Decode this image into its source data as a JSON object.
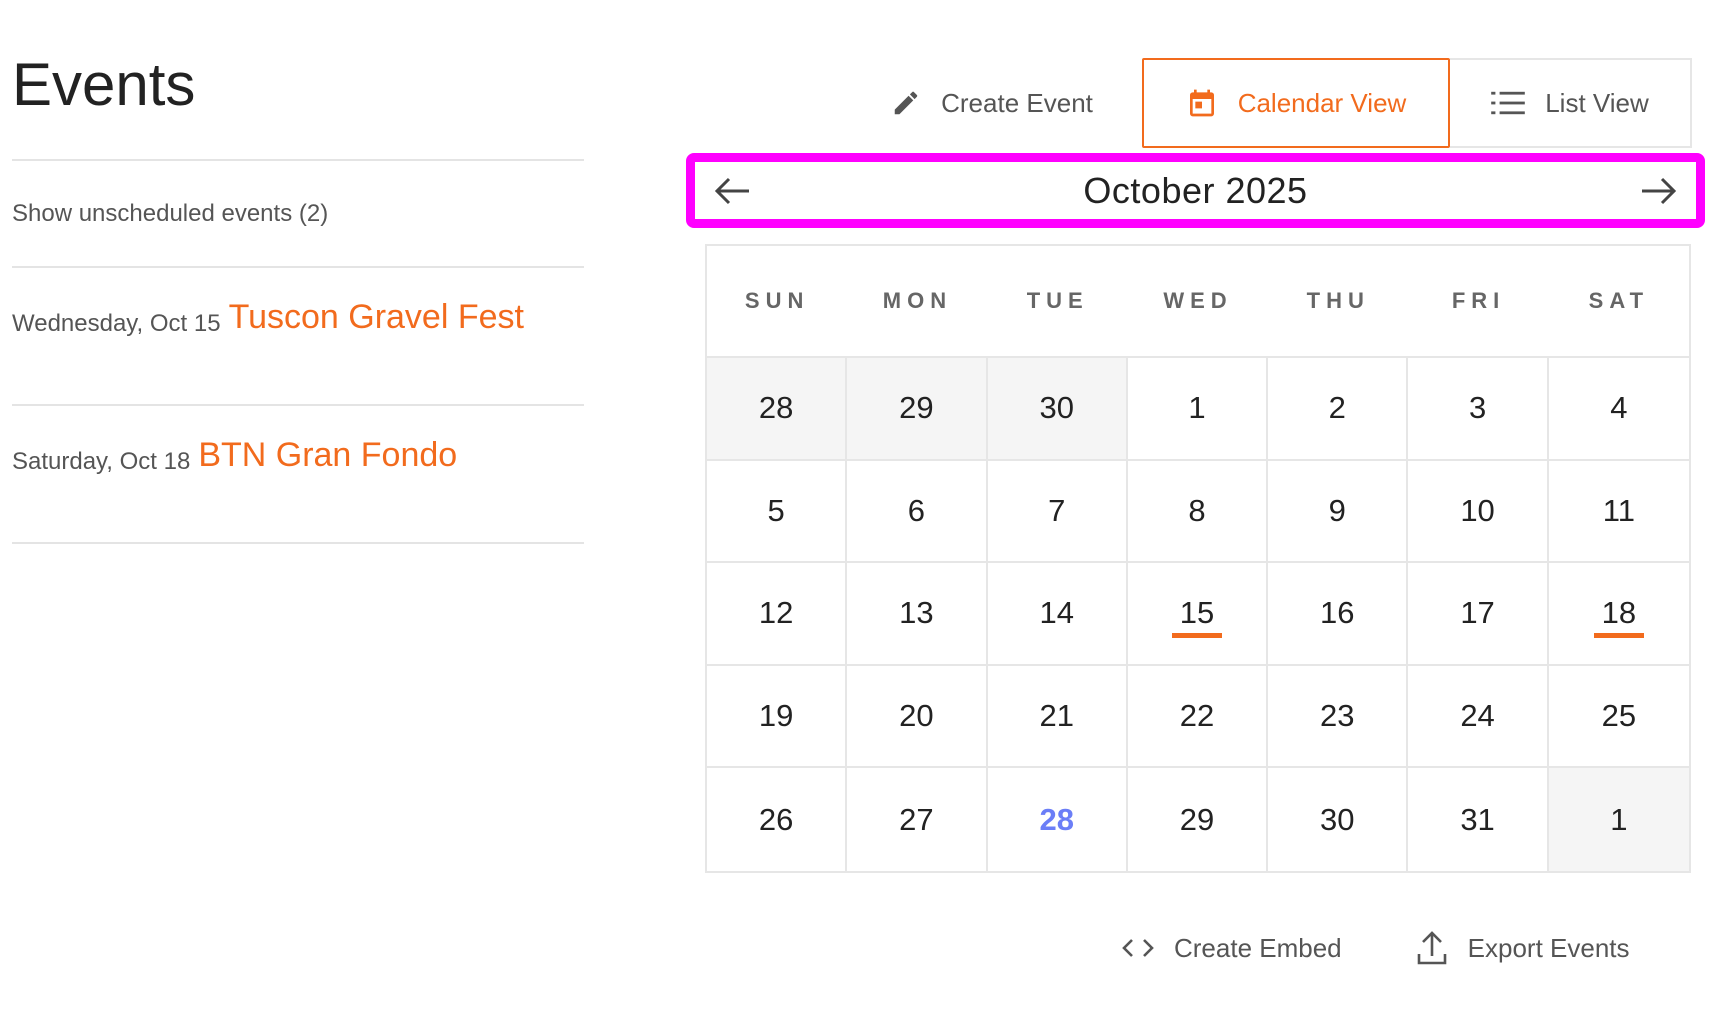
{
  "page": {
    "title": "Events"
  },
  "left": {
    "unscheduled_label": "Show unscheduled events (2)",
    "events": [
      {
        "date": "Wednesday, Oct 15",
        "name": "Tuscon Gravel Fest"
      },
      {
        "date": "Saturday, Oct 18",
        "name": "BTN Gran Fondo"
      }
    ]
  },
  "toolbar": {
    "create_label": "Create Event",
    "calendar_label": "Calendar View",
    "list_label": "List View"
  },
  "calendar": {
    "month_label": "October 2025",
    "weekdays": [
      "SUN",
      "MON",
      "TUE",
      "WED",
      "THU",
      "FRI",
      "SAT"
    ],
    "days": [
      {
        "d": "28",
        "other": true
      },
      {
        "d": "29",
        "other": true
      },
      {
        "d": "30",
        "other": true
      },
      {
        "d": "1"
      },
      {
        "d": "2"
      },
      {
        "d": "3"
      },
      {
        "d": "4"
      },
      {
        "d": "5"
      },
      {
        "d": "6"
      },
      {
        "d": "7"
      },
      {
        "d": "8"
      },
      {
        "d": "9"
      },
      {
        "d": "10"
      },
      {
        "d": "11"
      },
      {
        "d": "12"
      },
      {
        "d": "13"
      },
      {
        "d": "14"
      },
      {
        "d": "15",
        "event": true
      },
      {
        "d": "16"
      },
      {
        "d": "17"
      },
      {
        "d": "18",
        "event": true
      },
      {
        "d": "19"
      },
      {
        "d": "20"
      },
      {
        "d": "21"
      },
      {
        "d": "22"
      },
      {
        "d": "23"
      },
      {
        "d": "24"
      },
      {
        "d": "25"
      },
      {
        "d": "26"
      },
      {
        "d": "27"
      },
      {
        "d": "28",
        "today": true
      },
      {
        "d": "29"
      },
      {
        "d": "30"
      },
      {
        "d": "31"
      },
      {
        "d": "1",
        "other": true
      }
    ]
  },
  "actions": {
    "embed_label": "Create Embed",
    "export_label": "Export Events"
  },
  "colors": {
    "accent": "#f26b1d",
    "today": "#6b7ef7",
    "highlight": "#ff00ff"
  },
  "icons": {
    "create": "pencil-icon",
    "calendar": "calendar-icon",
    "list": "list-icon",
    "prev": "arrow-left-icon",
    "next": "arrow-right-icon",
    "embed": "code-icon",
    "export": "upload-icon"
  }
}
